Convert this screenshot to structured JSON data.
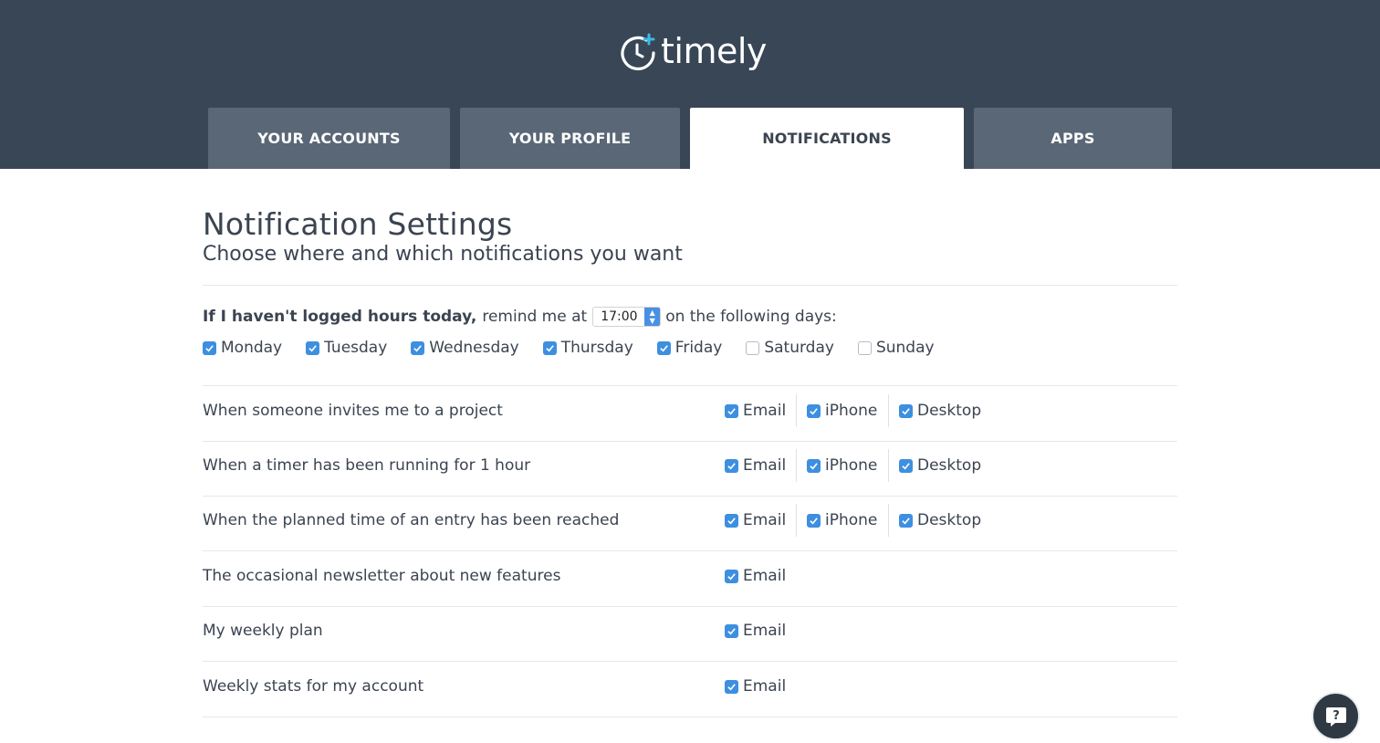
{
  "app": {
    "logo_text": "timely"
  },
  "tabs": [
    {
      "label": "YOUR ACCOUNTS",
      "active": false
    },
    {
      "label": "YOUR PROFILE",
      "active": false
    },
    {
      "label": "NOTIFICATIONS",
      "active": true
    },
    {
      "label": "APPS",
      "active": false
    }
  ],
  "page": {
    "title": "Notification Settings",
    "subtitle": "Choose where and which notifications you want"
  },
  "reminder": {
    "bold_prefix": "If I haven't logged hours today,",
    "text_before_time": "remind me at",
    "time_value": "17:00",
    "text_after_time": "on the following days:",
    "days": [
      {
        "label": "Monday",
        "checked": true
      },
      {
        "label": "Tuesday",
        "checked": true
      },
      {
        "label": "Wednesday",
        "checked": true
      },
      {
        "label": "Thursday",
        "checked": true
      },
      {
        "label": "Friday",
        "checked": true
      },
      {
        "label": "Saturday",
        "checked": false
      },
      {
        "label": "Sunday",
        "checked": false
      }
    ]
  },
  "notifications": [
    {
      "label": "When someone invites me to a project",
      "channels": [
        {
          "label": "Email",
          "checked": true
        },
        {
          "label": "iPhone",
          "checked": true
        },
        {
          "label": "Desktop",
          "checked": true
        }
      ]
    },
    {
      "label": "When a timer has been running for 1 hour",
      "channels": [
        {
          "label": "Email",
          "checked": true
        },
        {
          "label": "iPhone",
          "checked": true
        },
        {
          "label": "Desktop",
          "checked": true
        }
      ]
    },
    {
      "label": "When the planned time of an entry has been reached",
      "channels": [
        {
          "label": "Email",
          "checked": true
        },
        {
          "label": "iPhone",
          "checked": true
        },
        {
          "label": "Desktop",
          "checked": true
        }
      ]
    },
    {
      "label": "The occasional newsletter about new features",
      "channels": [
        {
          "label": "Email",
          "checked": true
        }
      ]
    },
    {
      "label": "My weekly plan",
      "channels": [
        {
          "label": "Email",
          "checked": true
        }
      ]
    },
    {
      "label": "Weekly stats for my account",
      "channels": [
        {
          "label": "Email",
          "checked": true
        }
      ]
    }
  ],
  "help_button": {
    "icon": "help-chat-icon",
    "glyph": "?"
  },
  "colors": {
    "header_bg": "#384656",
    "tab_bg": "#5a6776",
    "accent": "#3d8fe0",
    "logo_accent": "#3db8e8"
  }
}
